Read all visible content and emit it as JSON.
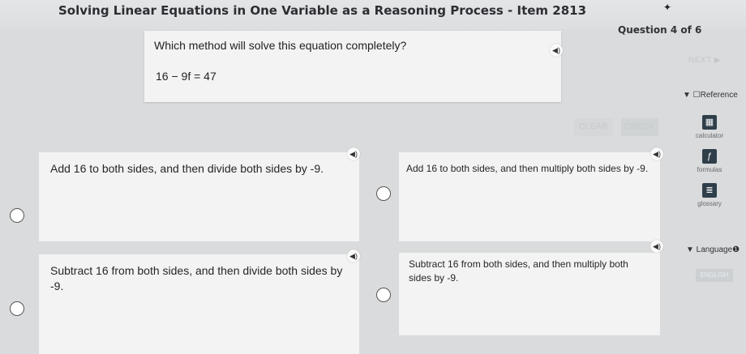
{
  "header": {
    "title": "Solving Linear Equations in One Variable as a Reasoning Process - Item 2813",
    "question_count": "Question 4 of 6"
  },
  "question": {
    "prompt": "Which method will solve this equation completely?",
    "equation": "16 − 9f = 47"
  },
  "controls": {
    "clear": "CLEAR",
    "check": "CHECK",
    "next": "NEXT ▶"
  },
  "reference": {
    "toggle_label": "▼ ☐Reference",
    "tools": [
      {
        "label": "calculator",
        "icon": "calculator-icon"
      },
      {
        "label": "formulas",
        "icon": "formulas-icon"
      },
      {
        "label": "glossary",
        "icon": "glossary-icon"
      }
    ]
  },
  "language": {
    "toggle_label": "▼ Language❶",
    "button": "ENGLISH"
  },
  "choices": [
    {
      "text": "Add 16 to both sides, and then divide both sides by -9."
    },
    {
      "text": "Add 16 to both sides, and then multiply both sides by -9."
    },
    {
      "text": "Subtract 16 from both sides, and then divide both sides by -9."
    },
    {
      "text": "Subtract 16 from both sides, and then multiply both sides by -9."
    }
  ],
  "colors": {
    "background": "#d9dbdc",
    "card": "#f3f3f3",
    "tool_icon": "#2f3f4a"
  }
}
